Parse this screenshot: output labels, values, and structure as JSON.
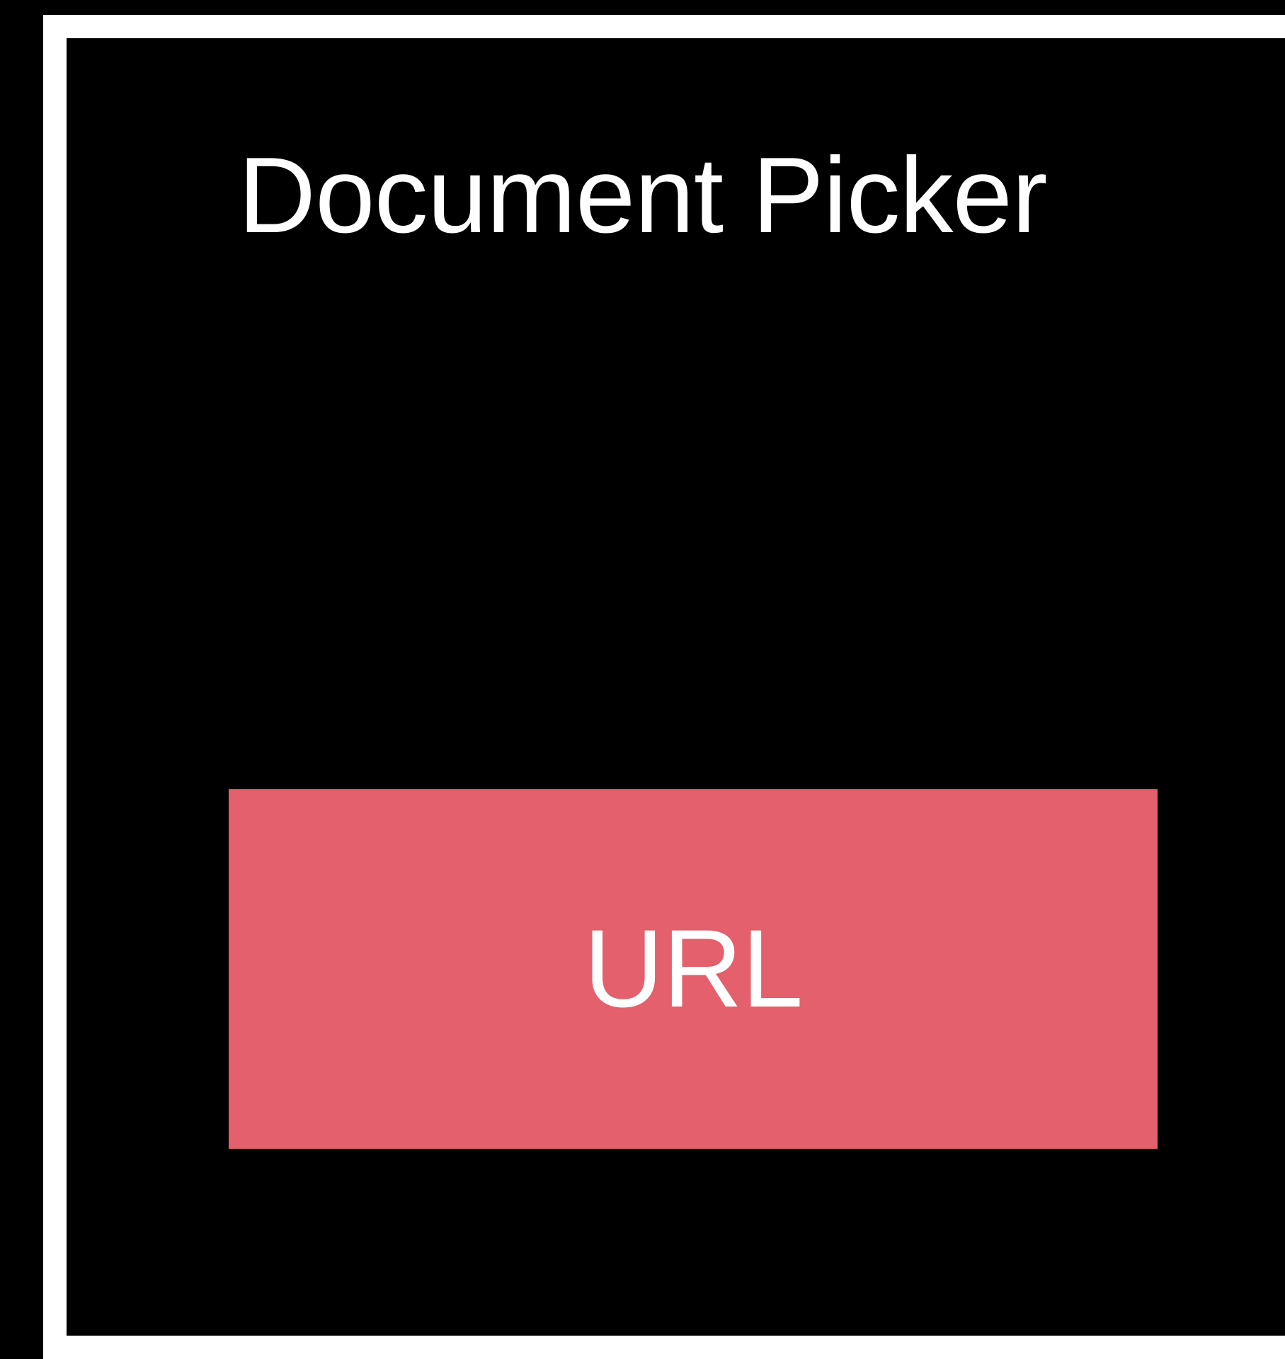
{
  "title": "Document Picker",
  "url_box": {
    "label": "URL",
    "color": "#e3606c"
  },
  "colors": {
    "background": "#000000",
    "frame": "#ffffff",
    "text": "#ffffff"
  }
}
